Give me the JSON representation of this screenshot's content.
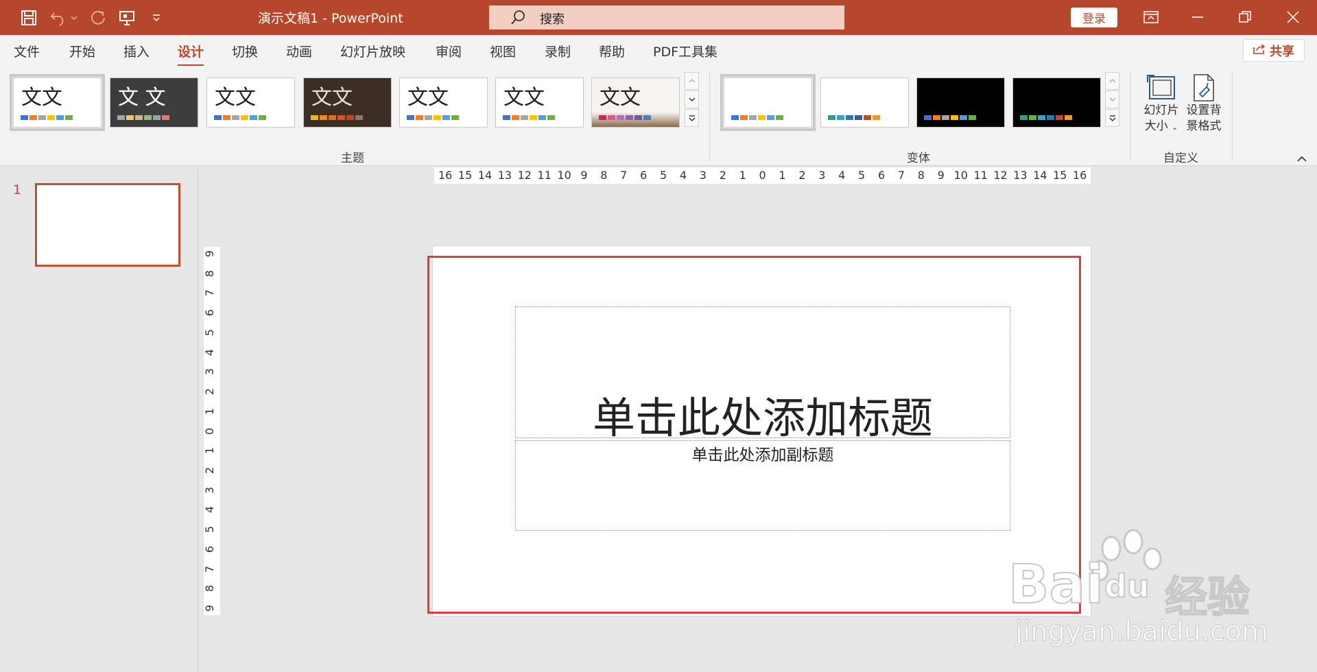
{
  "app": {
    "document_title": "演示文稿1  -  PowerPoint",
    "search_placeholder": "搜索",
    "login_label": "登录"
  },
  "quick_access": [
    "save-icon",
    "undo-icon",
    "redo-icon",
    "present-icon",
    "customize-icon"
  ],
  "menu": {
    "tabs": [
      "文件",
      "开始",
      "插入",
      "设计",
      "切换",
      "动画",
      "幻灯片放映",
      "审阅",
      "视图",
      "录制",
      "帮助",
      "PDF工具集"
    ],
    "active_tab": "设计",
    "share_label": "共享"
  },
  "ribbon": {
    "themes_group_label": "主题",
    "variants_group_label": "变体",
    "customize_group_label": "自定义",
    "theme_thumb_text": "文文",
    "theme_thumb_text_alt": "文 文",
    "slide_size_label_1": "幻灯片",
    "slide_size_label_2": "大小",
    "background_label_1": "设置背",
    "background_label_2": "景格式",
    "colors": {
      "accent": "#b7472a",
      "swatch_blue": "#4472c4",
      "swatch_orange": "#ed7d31",
      "swatch_gray": "#a5a5a5",
      "swatch_yellow": "#ffc000",
      "swatch_lightblue": "#5b9bd5",
      "swatch_green": "#70ad47"
    }
  },
  "slides_panel": {
    "slide_number": "1"
  },
  "rulers": {
    "horizontal": [
      "16",
      "15",
      "14",
      "13",
      "12",
      "11",
      "10",
      "9",
      "8",
      "7",
      "6",
      "5",
      "4",
      "3",
      "2",
      "1",
      "0",
      "1",
      "2",
      "3",
      "4",
      "5",
      "6",
      "7",
      "8",
      "9",
      "10",
      "11",
      "12",
      "13",
      "14",
      "15",
      "16"
    ],
    "vertical": [
      "9",
      "8",
      "7",
      "6",
      "5",
      "4",
      "3",
      "2",
      "1",
      "0",
      "1",
      "2",
      "3",
      "4",
      "5",
      "6",
      "7",
      "8",
      "9"
    ]
  },
  "slide": {
    "title_placeholder": "单击此处添加标题",
    "subtitle_placeholder": "单击此处添加副标题"
  },
  "watermark": {
    "brand": "Bai",
    "brand_suffix": "du",
    "product": "经验",
    "url": "jingyan.baidu.com"
  }
}
